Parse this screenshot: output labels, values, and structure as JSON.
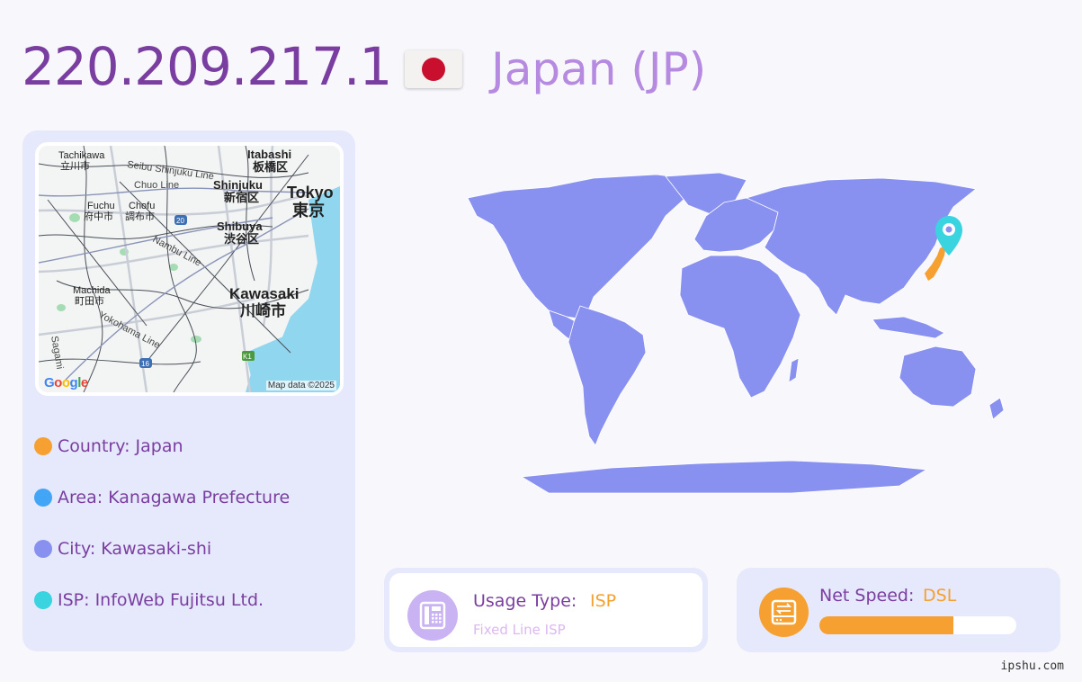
{
  "header": {
    "ip": "220.209.217.1",
    "country_title": "Japan (JP)",
    "flag_icon": "japan-flag-icon"
  },
  "mini_map": {
    "labels": {
      "tachikawa": "Tachikawa",
      "tachikawa_jp": "立川市",
      "seibu_line": "Seibu Shinjuku Line",
      "itabashi": "Itabashi",
      "itabashi_jp": "板橋区",
      "chuo_line": "Chuo Line",
      "shinjuku": "Shinjuku",
      "shinjuku_jp": "新宿区",
      "tokyo": "Tokyo",
      "tokyo_jp": "東京",
      "fuchu": "Fuchu",
      "fuchu_jp": "府中市",
      "chofu": "Chofu",
      "chofu_jp": "調布市",
      "route20": "20",
      "shibuya": "Shibuya",
      "shibuya_jp": "渋谷区",
      "nambu_line": "Nambu Line",
      "machida": "Machida",
      "machida_jp": "町田市",
      "kawasaki": "Kawasaki",
      "kawasaki_jp": "川崎市",
      "yokohama_line": "Yokohama Line",
      "sagami": "Sagami",
      "route16": "16",
      "k1": "K1"
    },
    "google_logo": "Google",
    "credit": "Map data ©2025"
  },
  "info": {
    "country": "Country: Japan",
    "area": "Area: Kanagawa Prefecture",
    "city": "City: Kawasaki-shi",
    "isp": "ISP: InfoWeb Fujitsu Ltd."
  },
  "colors": {
    "country_dot": "#f5a030",
    "area_dot": "#42a5f5",
    "city_dot": "#8890f0",
    "isp_dot": "#3ad3e0",
    "land": "#8890f0",
    "highlight": "#f5a030",
    "pin": "#3ad3e0"
  },
  "usage": {
    "label": "Usage Type:",
    "value": "ISP",
    "sub": "Fixed Line ISP",
    "icon": "fax-phone-icon"
  },
  "speed": {
    "label": "Net Speed:",
    "value": "DSL",
    "level": 0.68,
    "icon": "network-drive-icon"
  },
  "watermark": "ipshu.com"
}
